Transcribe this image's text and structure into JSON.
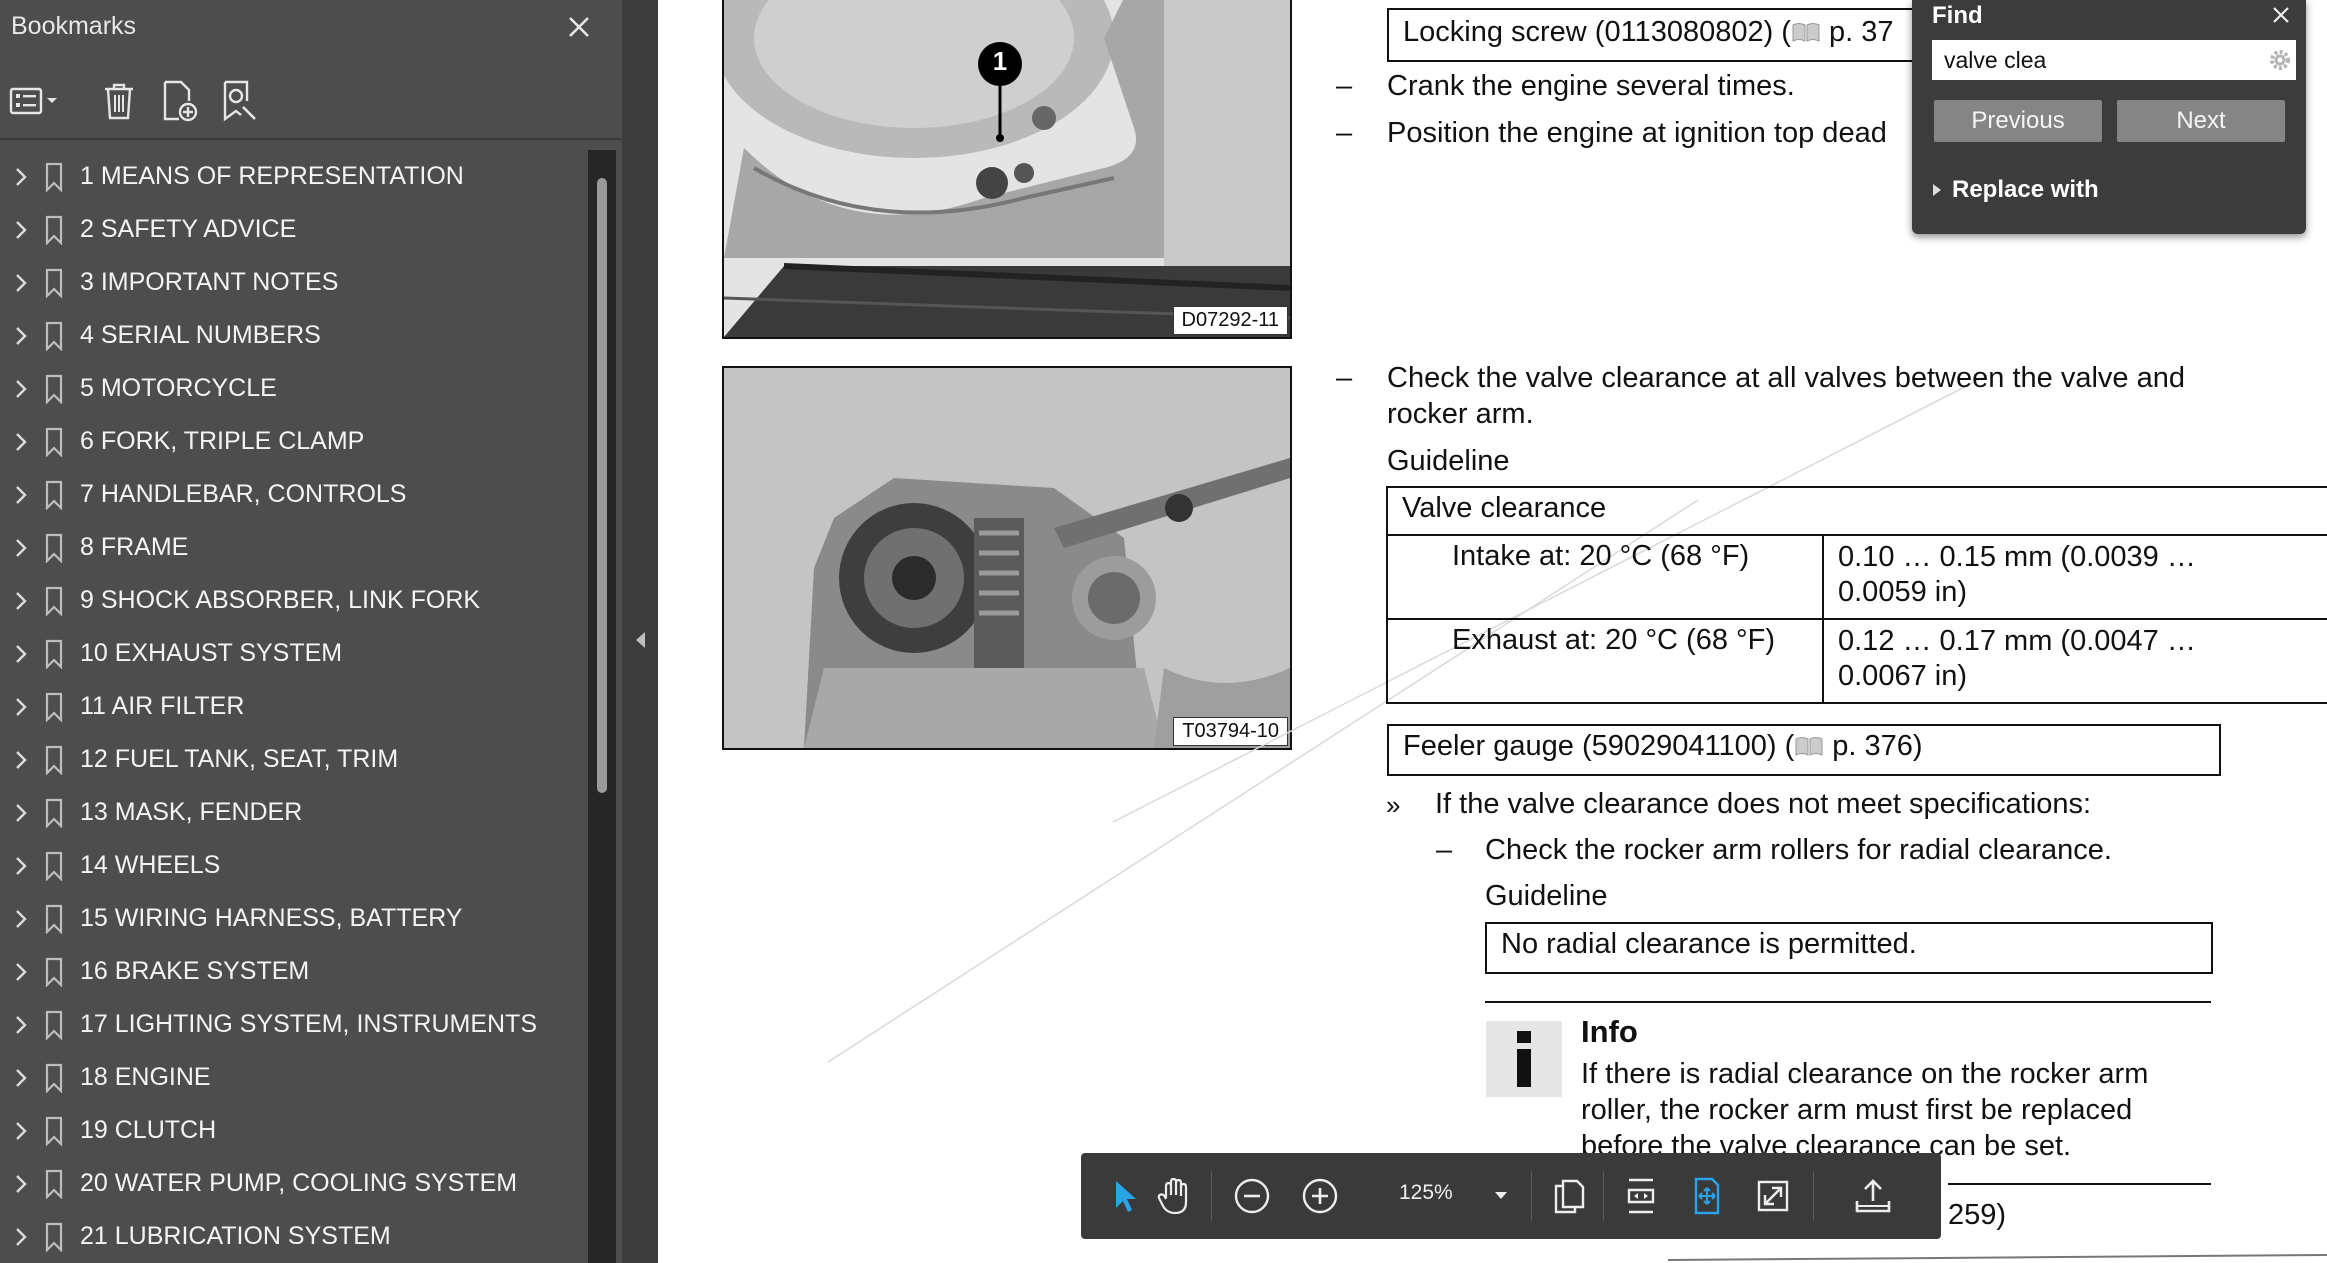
{
  "sidebar": {
    "title": "Bookmarks",
    "items": [
      {
        "label": "1 MEANS OF REPRESENTATION"
      },
      {
        "label": "2 SAFETY ADVICE"
      },
      {
        "label": "3 IMPORTANT NOTES"
      },
      {
        "label": "4 SERIAL NUMBERS"
      },
      {
        "label": "5 MOTORCYCLE"
      },
      {
        "label": "6 FORK, TRIPLE CLAMP"
      },
      {
        "label": "7 HANDLEBAR, CONTROLS"
      },
      {
        "label": "8 FRAME"
      },
      {
        "label": "9 SHOCK ABSORBER, LINK FORK"
      },
      {
        "label": "10 EXHAUST SYSTEM"
      },
      {
        "label": "11 AIR FILTER"
      },
      {
        "label": "12 FUEL TANK, SEAT, TRIM"
      },
      {
        "label": "13 MASK, FENDER"
      },
      {
        "label": "14 WHEELS"
      },
      {
        "label": "15 WIRING HARNESS, BATTERY"
      },
      {
        "label": "16 BRAKE SYSTEM"
      },
      {
        "label": "17 LIGHTING SYSTEM, INSTRUMENTS"
      },
      {
        "label": "18 ENGINE"
      },
      {
        "label": "19 CLUTCH"
      },
      {
        "label": "20 WATER PUMP, COOLING SYSTEM"
      },
      {
        "label": "21 LUBRICATION SYSTEM"
      }
    ]
  },
  "document": {
    "photo1": {
      "code": "D07292-11",
      "callout": "1"
    },
    "photo2": {
      "code": "T03794-10"
    },
    "locking_screw": "Locking screw (0113080802) (",
    "locking_screw_page": " p. 37",
    "step_crank": "Crank the engine several times.",
    "step_position": "Position the engine at ignition top dead",
    "step_check_line1": "Check the valve clearance at all valves between the valve and",
    "step_check_line2": "rocker arm.",
    "guideline1": "Guideline",
    "valve_table": {
      "header": "Valve clearance",
      "rows": [
        {
          "label": "Intake at: 20 °C (68 °F)",
          "value_line1": "0.10 … 0.15 mm (0.0039 …",
          "value_line2": "0.0059 in)"
        },
        {
          "label": "Exhaust at: 20 °C (68 °F)",
          "value_line1": "0.12 … 0.17 mm (0.0047 …",
          "value_line2": "0.0067 in)"
        }
      ]
    },
    "feeler_gauge": "Feeler gauge (59029041100) (",
    "feeler_gauge_page": " p. 376)",
    "condition_marker": "»",
    "condition": "If the valve clearance does not meet specifications:",
    "step_rocker": "Check the rocker arm rollers for radial clearance.",
    "guideline2": "Guideline",
    "no_clearance": "No radial clearance is permitted.",
    "info": {
      "title": "Info",
      "line1": "If there is radial clearance on the rocker arm",
      "line2": "roller, the rocker arm must first be replaced",
      "line3": "before the valve clearance can be set."
    },
    "footer_partial": "259)",
    "dash": "–"
  },
  "find": {
    "title": "Find",
    "query": "valve clea",
    "previous_label": "Previous",
    "next_label": "Next",
    "replace_label": "Replace with"
  },
  "bottom_toolbar": {
    "zoom": "125%"
  },
  "colors": {
    "sidebar_bg": "#4d4d4d",
    "toolbar_bg": "#3a3a3a",
    "accent_blue": "#2aa3e8"
  }
}
